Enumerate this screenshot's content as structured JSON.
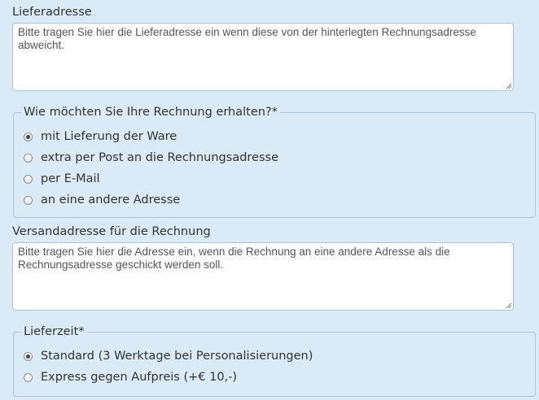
{
  "delivery_address": {
    "label": "Lieferadresse",
    "placeholder": "Bitte tragen Sie hier die Lieferadresse ein wenn diese von der hinterlegten Rechnungsadresse abweicht."
  },
  "invoice_method": {
    "legend": "Wie möchten Sie Ihre Rechnung erhalten?*",
    "options": [
      {
        "label": "mit Lieferung der Ware",
        "checked": true
      },
      {
        "label": "extra per Post an die Rechnungsadresse",
        "checked": false
      },
      {
        "label": "per E-Mail",
        "checked": false
      },
      {
        "label": "an eine andere Adresse",
        "checked": false
      }
    ]
  },
  "invoice_shipping_address": {
    "label": "Versandadresse für die Rechnung",
    "placeholder": "Bitte tragen Sie hier die Adresse ein, wenn die Rechnung an eine andere Adresse als die Rechnungsadresse geschickt werden soll."
  },
  "delivery_time": {
    "legend": "Lieferzeit*",
    "options": [
      {
        "label": "Standard (3 Werktage bei Personalisierungen)",
        "checked": true
      },
      {
        "label": "Express gegen Aufpreis (+€ 10,-)",
        "checked": false
      }
    ]
  },
  "colors": {
    "background": "#daeaf6",
    "border": "#a9c6dc",
    "text": "#333333"
  }
}
